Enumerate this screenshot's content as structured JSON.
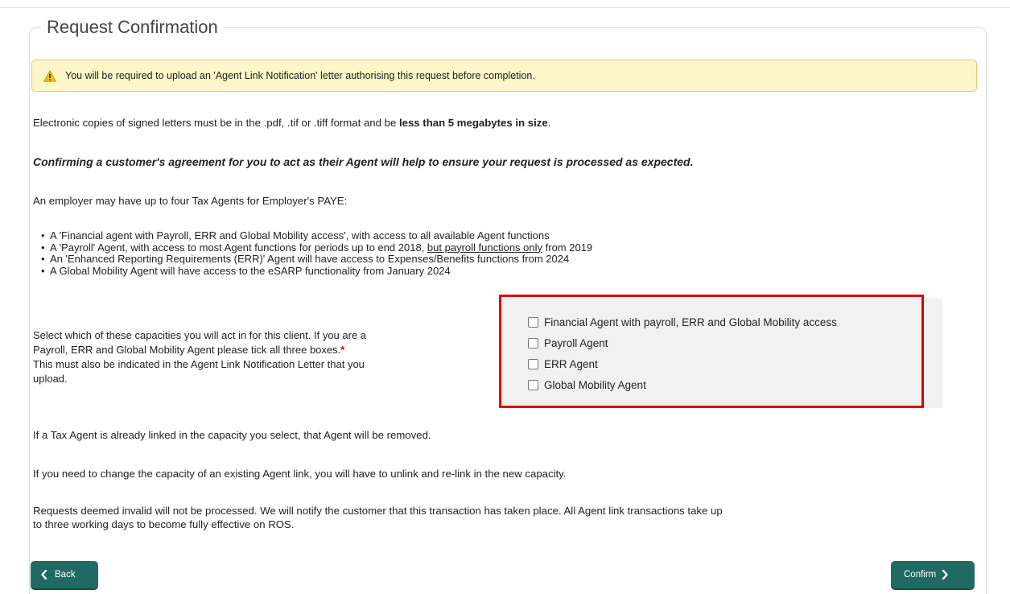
{
  "page": {
    "section_title": "Request Confirmation",
    "warning": {
      "icon": "warning-triangle-icon",
      "text": "You will be required to upload an 'Agent Link Notification' letter authorising this request before completion."
    },
    "format_note": {
      "prefix": "Electronic copies of signed letters must be in the .pdf, .tif or .tiff format and be ",
      "bold": "less than 5 megabytes in size",
      "suffix": "."
    },
    "emphasis": "Confirming a customer's agreement for you to act as their Agent will help to ensure your request is processed as expected.",
    "intro": "An employer may have up to four Tax Agents for Employer's PAYE:",
    "bullets": {
      "b1": "A 'Financial agent with Payroll, ERR and Global Mobility access', with access to all available Agent functions",
      "b2_prefix": "A 'Payroll' Agent, with access to most Agent functions for periods up to end 2018, ",
      "b2_underline": "but payroll functions only",
      "b2_suffix": " from 2019",
      "b3": "An 'Enhanced Reporting Requirements (ERR)' Agent will have access to Expenses/Benefits functions from 2024",
      "b4": "A Global Mobility Agent will have access to the eSARP functionality from January 2024"
    },
    "capacity": {
      "line1": "Select which of these capacities you will act in for this client. If you are a",
      "line2": "Payroll, ERR and Global Mobility Agent please tick all three boxes.",
      "required_mark": "*",
      "line3": "This must also be indicated in the Agent Link Notification Letter that you",
      "line4": "upload.",
      "options": [
        {
          "label": "Financial Agent with payroll, ERR and Global Mobility access",
          "checked": false
        },
        {
          "label": "Payroll Agent",
          "checked": false
        },
        {
          "label": "ERR Agent",
          "checked": false
        },
        {
          "label": "Global Mobility Agent",
          "checked": false
        }
      ]
    },
    "note_linked": "If a Tax Agent is already linked in the capacity you select, that Agent will be removed.",
    "note_change": "If you need to change the capacity of an existing Agent link, you will have to unlink and re-link in the new capacity.",
    "note_invalid_1": "Requests deemed invalid will not be processed. We will notify the customer that this transaction has taken place. All Agent link transactions take up",
    "note_invalid_2": "to three working days to become fully effective on ROS.",
    "back_label": "Back",
    "confirm_label": "Confirm",
    "colors": {
      "button": "#1f6b63",
      "warning_bg": "#fdf6c9",
      "warning_border": "#f0c36d",
      "highlight_border": "#e10000",
      "panel_bg": "#f1f1f1"
    }
  }
}
